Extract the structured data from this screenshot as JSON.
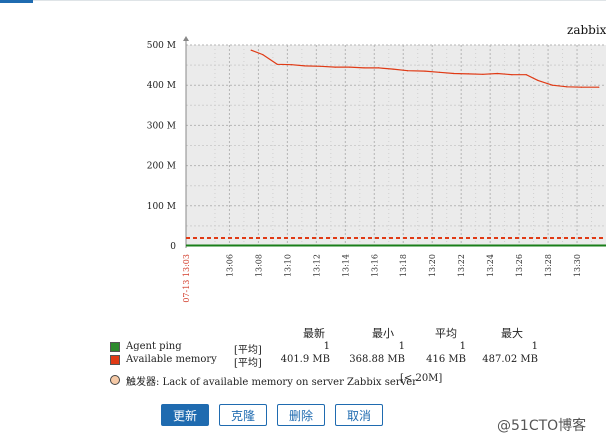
{
  "host_label": "zabbix",
  "chart_data": {
    "type": "line",
    "y_ticks": [
      "0",
      "100 M",
      "200 M",
      "300 M",
      "400 M",
      "500 M"
    ],
    "ylim": [
      0,
      500
    ],
    "start_label": "07-13 13:03",
    "x_ticks": [
      "13:06",
      "13:08",
      "13:10",
      "13:12",
      "13:14",
      "13:16",
      "13:18",
      "13:20",
      "13:22",
      "13:24",
      "13:26",
      "13:28",
      "13:30"
    ],
    "grid": true,
    "series": [
      {
        "name": "Available memory",
        "color": "#e03a15",
        "x": [
          "13:07.5",
          "13:08.3",
          "13:09.3",
          "13:10.3",
          "13:11.2",
          "13:12.3",
          "13:13.3",
          "13:14.3",
          "13:15.3",
          "13:16.3",
          "13:17.3",
          "13:18.3",
          "13:19.5",
          "13:20.5",
          "13:21.5",
          "13:22.5",
          "13:23.5",
          "13:24.5",
          "13:25.5",
          "13:26.5",
          "13:27.3",
          "13:28.3",
          "13:29.3",
          "13:30.3",
          "13:31.5"
        ],
        "values": [
          487,
          476,
          452,
          451,
          448,
          447,
          445,
          445,
          443,
          443,
          440,
          436,
          435,
          432,
          429,
          428,
          427,
          429,
          426,
          426,
          412,
          400,
          396,
          395,
          395
        ]
      },
      {
        "name": "Agent ping",
        "color": "#1a7f1a",
        "values_const": 1
      }
    ],
    "trigger_line": {
      "value": 20,
      "color": "#e03a15"
    }
  },
  "legend": {
    "headers": [
      "最新",
      "最小",
      "平均",
      "最大"
    ],
    "items": [
      {
        "name": "Agent ping",
        "fn": "[平均]",
        "color": "#2d8a2d",
        "last": "1",
        "min": "1",
        "avg": "1",
        "max": "1"
      },
      {
        "name": "Available memory",
        "fn": "[平均]",
        "color": "#e03a15",
        "last": "401.9 MB",
        "min": "368.88 MB",
        "avg": "416 MB",
        "max": "487.02 MB"
      }
    ],
    "trigger": {
      "label": "触发器: Lack of available memory on server Zabbix server",
      "cond": "[< 20M]"
    }
  },
  "buttons": {
    "update": "更新",
    "clone": "克隆",
    "delete": "删除",
    "cancel": "取消"
  },
  "watermark": "@51CTO博客"
}
